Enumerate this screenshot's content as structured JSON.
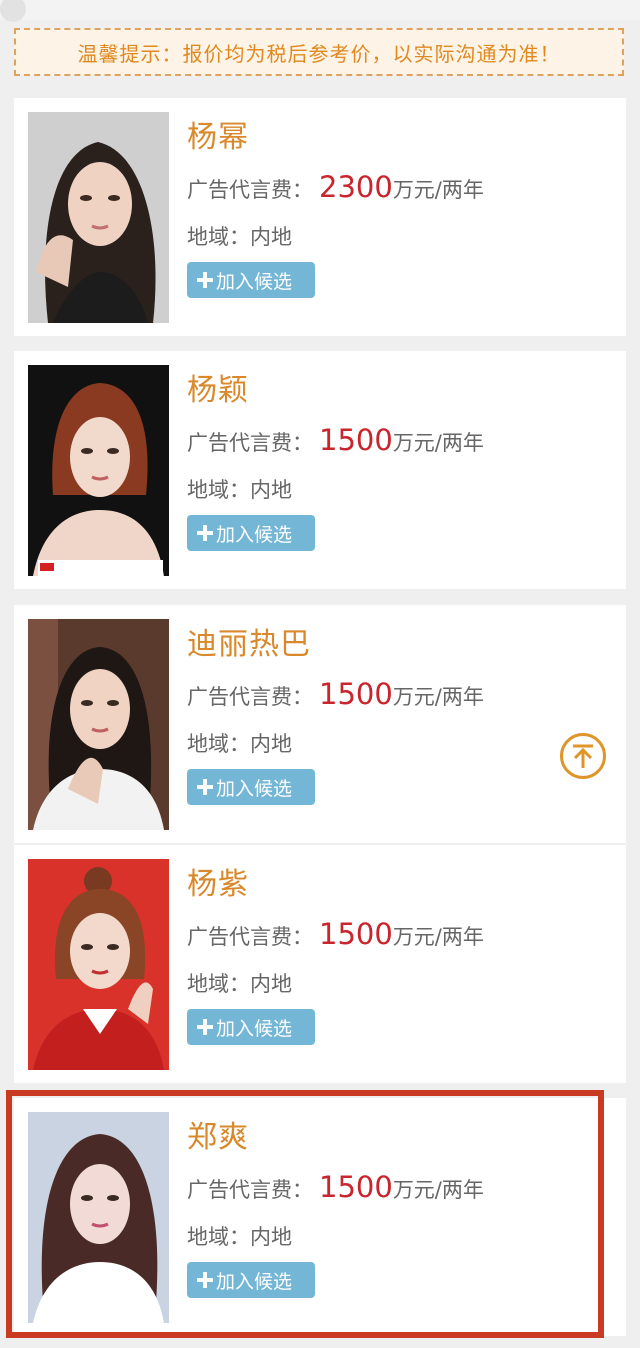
{
  "notice": "温馨提示：报价均为税后参考价，以实际沟通为准！",
  "labels": {
    "fee_label": "广告代言费：",
    "unit": "万元/两年",
    "add_button": "加入候选"
  },
  "celebrities": [
    {
      "name": "杨幂",
      "fee": "2300",
      "region": "地域：内地",
      "photo_bg": "#cfcfcf"
    },
    {
      "name": "杨颖",
      "fee": "1500",
      "region": "地域：内地",
      "photo_bg": "#111111"
    },
    {
      "name": "迪丽热巴",
      "fee": "1500",
      "region": "地域：内地",
      "photo_bg": "#5a3a2c"
    },
    {
      "name": "杨紫",
      "fee": "1500",
      "region": "地域：内地",
      "photo_bg": "#d8322a"
    },
    {
      "name": "郑爽",
      "fee": "1500",
      "region": "地域：内地",
      "photo_bg": "#c9d3e2"
    }
  ],
  "colors": {
    "accent": "#d9882b",
    "price": "#c9252c",
    "button": "#73b6d6",
    "highlight": "#c93a22"
  },
  "icons": {
    "back_to_top": "arrow-up-to-line-icon"
  }
}
